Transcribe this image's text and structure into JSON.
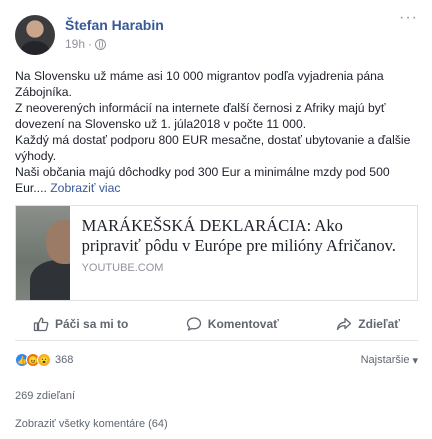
{
  "post": {
    "author": "Štefan Harabin",
    "time": "19h",
    "separator": "·",
    "lines": [
      "Na Slovensku už máme asi 10 000 migrantov podľa vyjadrenia pána Zábojníka.",
      "Z neoverených informácií na internete ďalší černosi z Afriky majú byť dovezení na Slovensko už 1. júla2018 v počte 11 000.",
      "Každý má dostať podporu 800 EUR mesačne, dostať ubytovanie a ďalšie výhody.",
      "Naši občania majú dôchodky pod 300 Eur a minimálne mzdy pod 500 Eur...."
    ],
    "see_more": "Zobraziť viac"
  },
  "link": {
    "title": "MARÁKEŠSKÁ DEKLARÁCIA: Ako pripraviť pôdu v Európe pre milióny Afričanov.",
    "domain": "YOUTUBE.COM"
  },
  "actions": {
    "like": "Páči sa mi to",
    "comment": "Komentovať",
    "share": "Zdieľať"
  },
  "reactions": {
    "count": "368",
    "sort_label": "Najstaršie"
  },
  "stats": {
    "shares": "269 zdieľaní",
    "view_comments": "Zobraziť všetky komentáre (64)"
  },
  "colors": {
    "link_blue": "#385898",
    "like_blue": "#2d88ff",
    "angry_orange": "#e9710f",
    "wow_yellow": "#f7b125"
  }
}
